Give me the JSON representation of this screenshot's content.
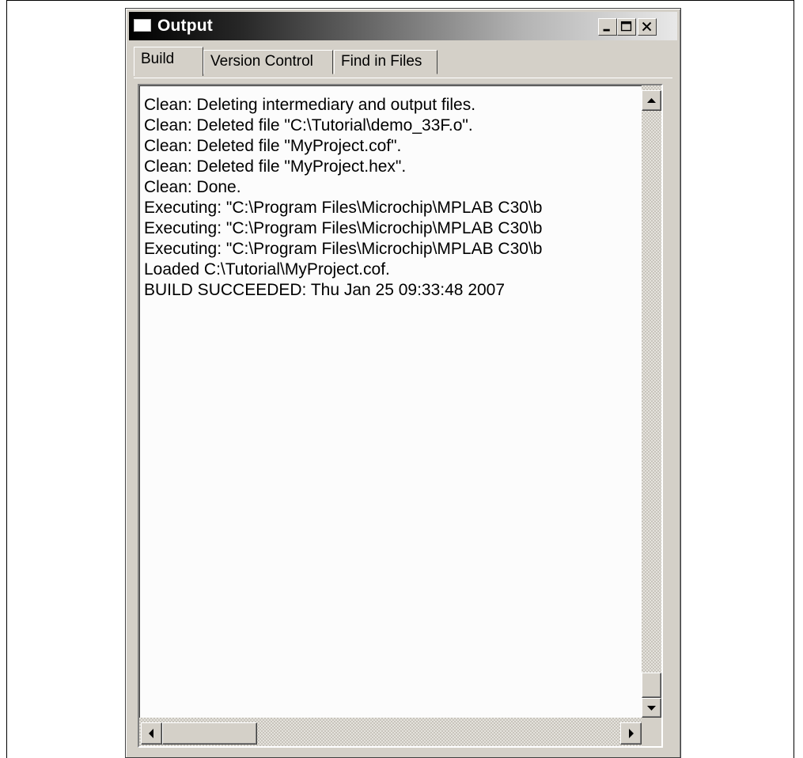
{
  "window": {
    "title": "Output",
    "controls": {
      "minimize": "minimize-icon",
      "maximize": "maximize-icon",
      "close": "close-icon"
    }
  },
  "tabs": [
    {
      "label": "Build",
      "active": true
    },
    {
      "label": "Version Control",
      "active": false
    },
    {
      "label": "Find in Files",
      "active": false
    }
  ],
  "output_lines": [
    "Clean: Deleting intermediary and output files.",
    "Clean: Deleted file \"C:\\Tutorial\\demo_33F.o\".",
    "Clean: Deleted file \"MyProject.cof\".",
    "Clean: Deleted file \"MyProject.hex\".",
    "Clean: Done.",
    "Executing: \"C:\\Program Files\\Microchip\\MPLAB C30\\b",
    "Executing: \"C:\\Program Files\\Microchip\\MPLAB C30\\b",
    "Executing: \"C:\\Program Files\\Microchip\\MPLAB C30\\b",
    "Loaded C:\\Tutorial\\MyProject.cof.",
    "BUILD SUCCEEDED: Thu Jan 25 09:33:48 2007"
  ],
  "scrollbars": {
    "vertical_position": 1.0,
    "horizontal_position": 0.0
  },
  "colors": {
    "window_face": "#d4d0c8",
    "titlebar_start": "#000000",
    "titlebar_end": "#e8e8e8",
    "output_background": "#fcfcfc"
  }
}
